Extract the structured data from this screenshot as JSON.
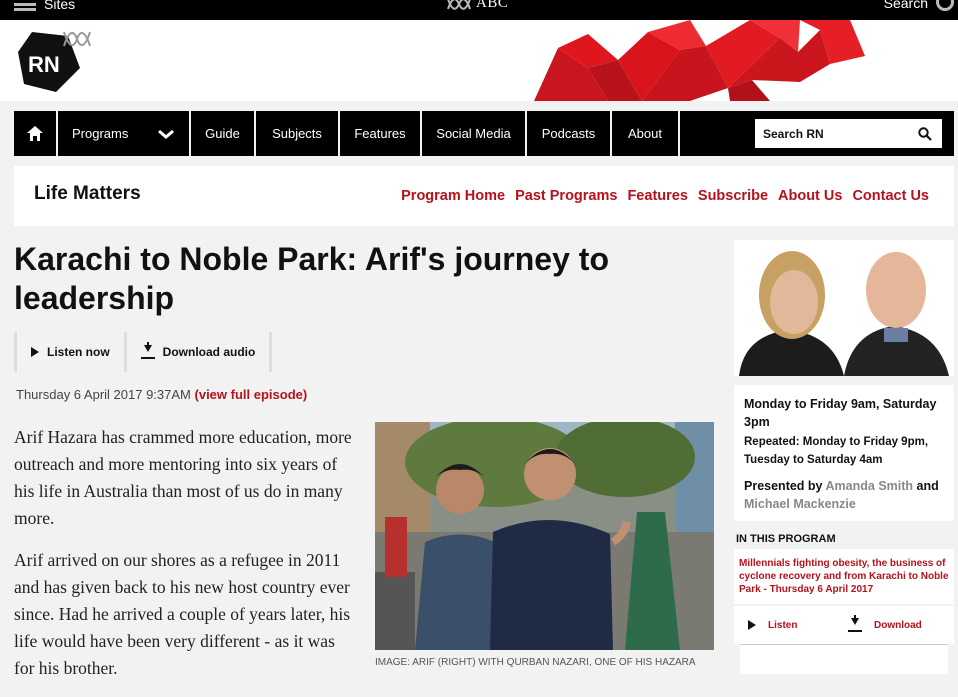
{
  "topbar": {
    "sites_label": "Sites",
    "abc_label": "ABC",
    "search_label": "Search",
    "menu_icon": "hamburger-icon",
    "search_icon": "search-icon"
  },
  "brand": {
    "logo_text": "RN",
    "accent_color": "#e0161f"
  },
  "nav": {
    "items": [
      "Programs",
      "Guide",
      "Subjects",
      "Features",
      "Social Media",
      "Podcasts",
      "About"
    ],
    "search_placeholder": "Search RN",
    "home_icon": "home-icon",
    "programs_icon": "chevron-down-icon"
  },
  "program": {
    "title": "Life Matters",
    "links": [
      "Program Home",
      "Past Programs",
      "Features",
      "Subscribe",
      "About Us",
      "Contact Us"
    ],
    "link_color": "#b5121b"
  },
  "article": {
    "headline": "Karachi to Noble Park: Arif's journey to leadership",
    "listen_label": "Listen now",
    "download_label": "Download audio",
    "date": "Thursday 6 April 2017 9:37AM",
    "full_episode_label": "(view full episode)",
    "paragraphs": [
      "Arif Hazara has crammed more education, more outreach and more mentoring into six years of his life in Australia than most of us do in many more.",
      "Arif arrived on our shores as a refugee in 2011 and has given back to his new host country ever since. Had he arrived a couple of years later, his life would have been very different - as it was for his brother."
    ],
    "caption": "IMAGE: ARIF (RIGHT) WITH QURBAN NAZARI, ONE OF HIS HAZARA"
  },
  "sidebar": {
    "schedule": "Monday to Friday 9am, Saturday 3pm",
    "repeated": "Repeated: Monday to Friday 9pm, Tuesday to Saturday 4am",
    "presented_by": "Presented by",
    "presenter_1": "Amanda Smith",
    "and_label": "and",
    "presenter_2": "Michael Mackenzie",
    "in_this_program": "IN THIS PROGRAM",
    "episode_title": "Millennials fighting obesity, the business of cyclone recovery and from Karachi to Noble Park - Thursday 6 April 2017",
    "listen_label": "Listen",
    "download_label": "Download"
  }
}
